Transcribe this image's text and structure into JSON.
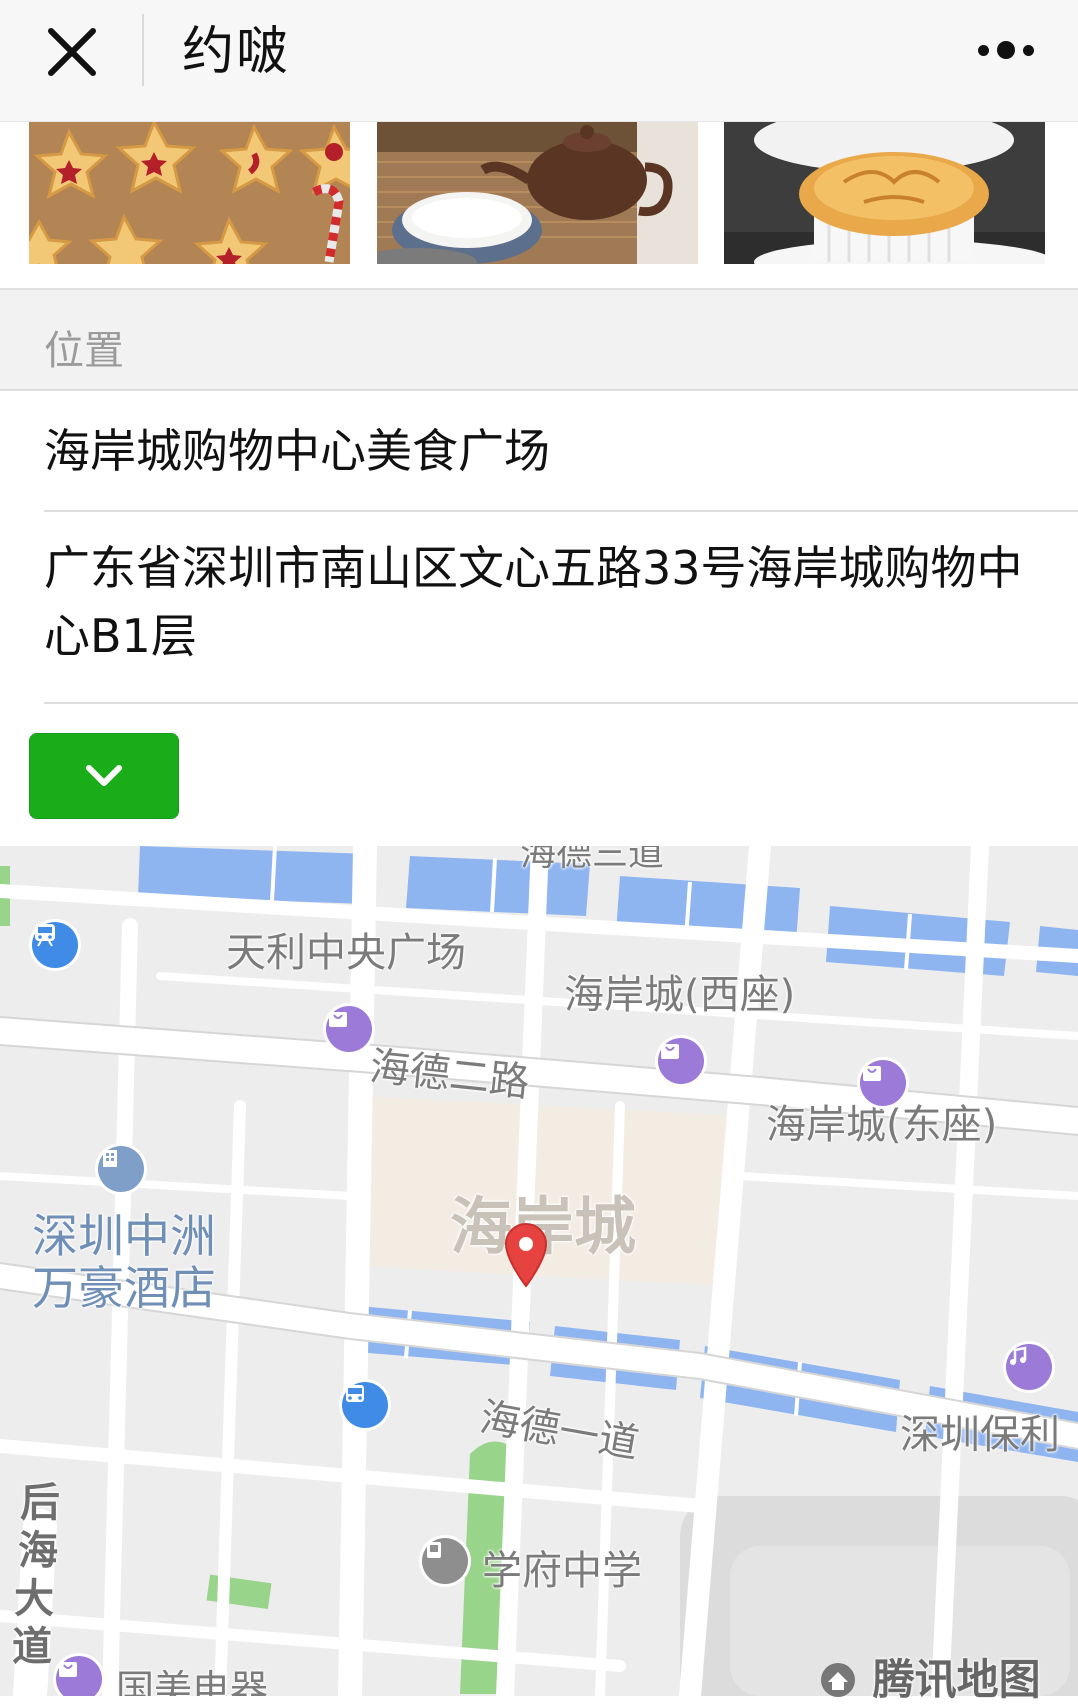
{
  "topbar": {
    "title": "约啵",
    "close_icon": "close-icon",
    "more_icon": "more-dots-icon"
  },
  "photos": [
    {
      "name": "star-cookies-photo"
    },
    {
      "name": "teapot-photo"
    },
    {
      "name": "pot-pie-photo"
    }
  ],
  "location": {
    "section_label": "位置",
    "place_name": "海岸城购物中心美食广场",
    "address": "广东省深圳市南山区文心五路33号海岸城购物中心B1层",
    "expand_icon": "chevron-down-icon",
    "expand_button_color": "#1aad19"
  },
  "map": {
    "labels": {
      "road_top": "海德三道",
      "tianli": "天利中央广场",
      "west": "海岸城(西座)",
      "east": "海岸城(东座)",
      "haide2": "海德二路",
      "haiancheng": "海岸城",
      "zhongzhou_1": "深圳中洲",
      "zhongzhou_2": "万豪酒店",
      "haide1": "海德一道",
      "poly": "深圳保利",
      "houhai_1": "后",
      "houhai_2": "海",
      "houhai_3": "大",
      "houhai_4": "道",
      "school": "学府中学",
      "gome": "国美电器",
      "watermark": "腾讯地图"
    },
    "marker_color": "#e64340",
    "water_color": "#8fb5f1",
    "park_color": "#98d48a"
  }
}
